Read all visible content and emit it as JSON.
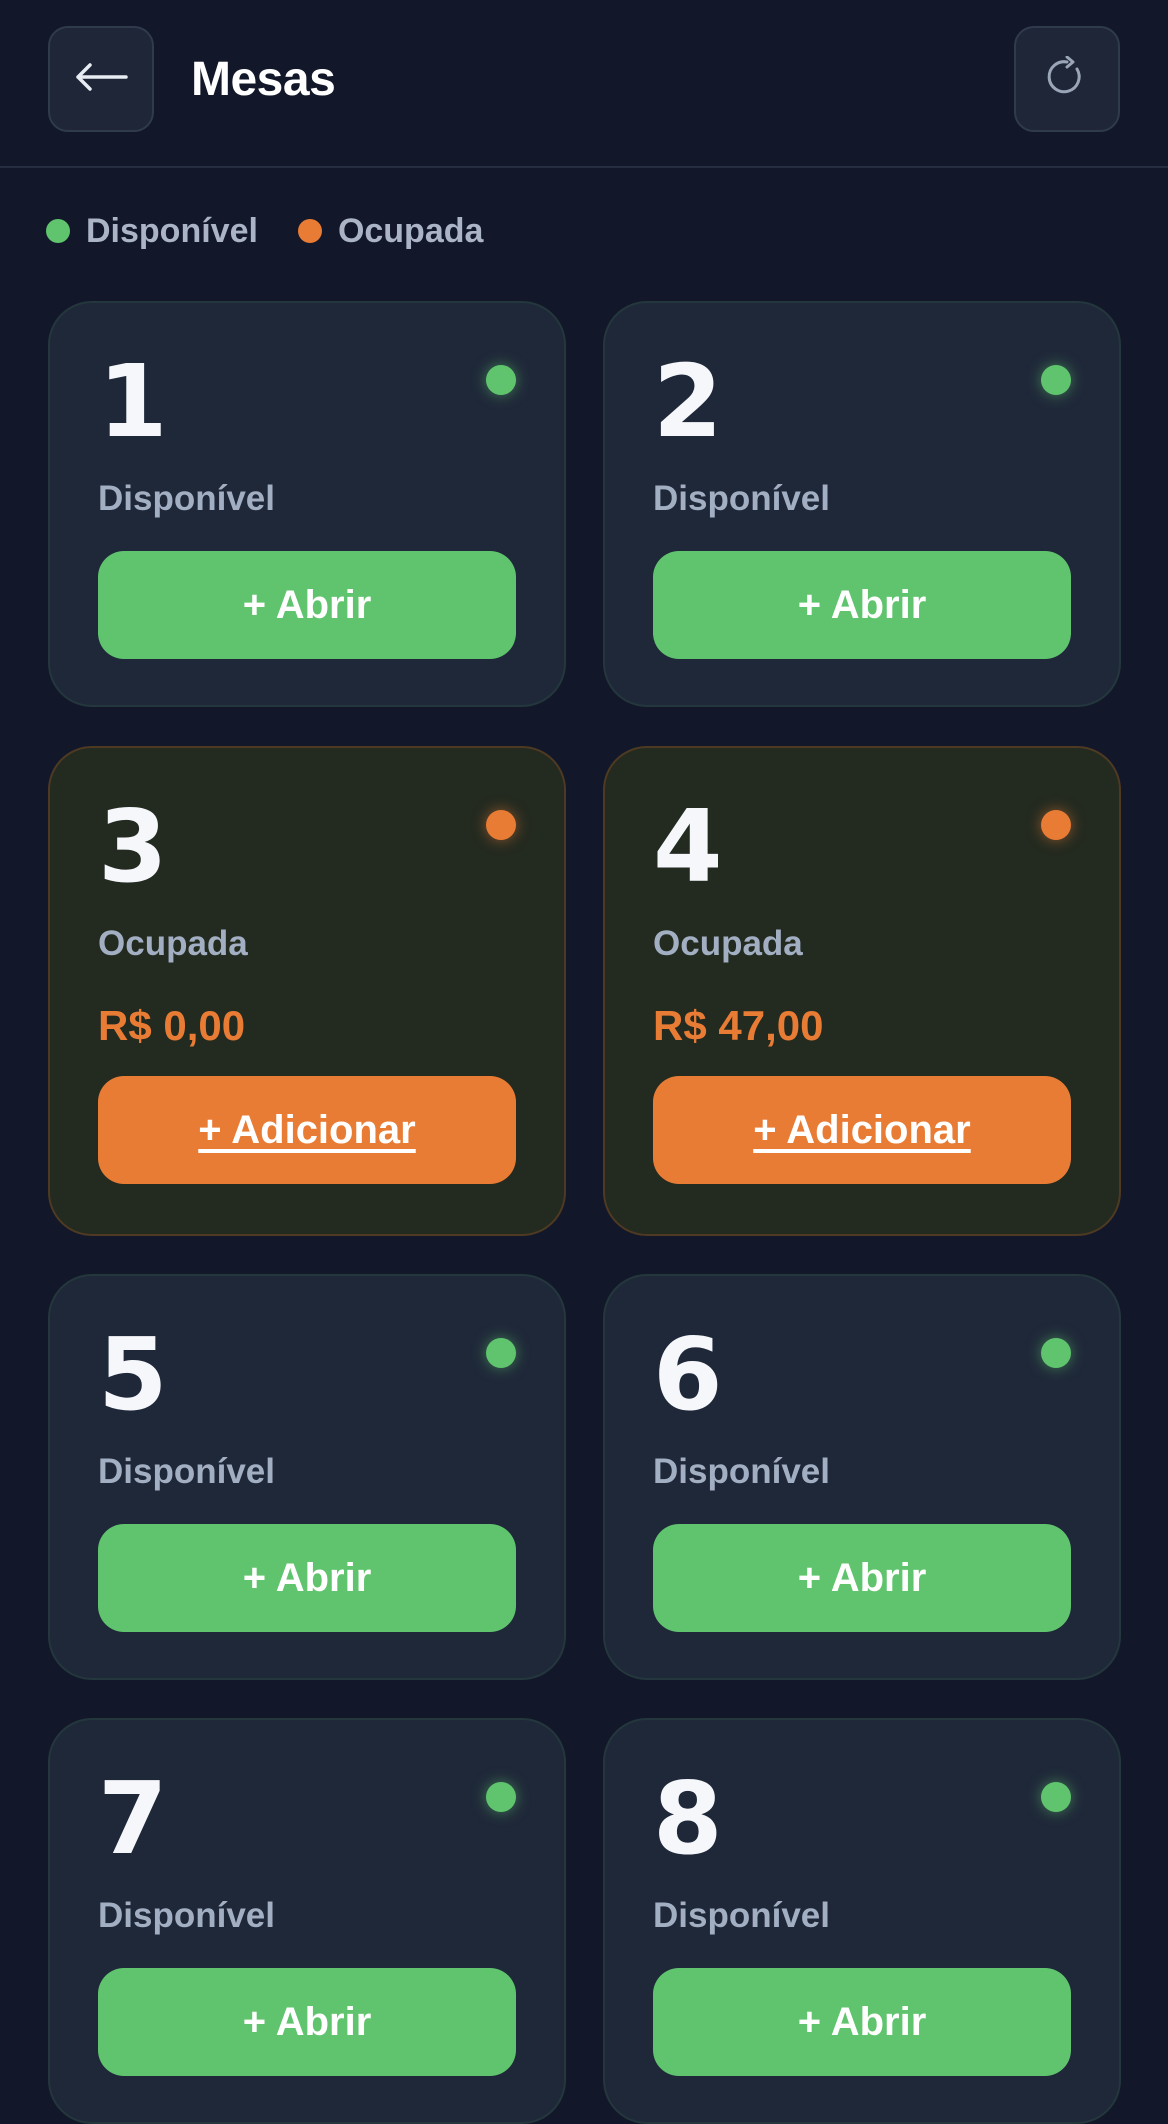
{
  "header": {
    "title": "Mesas",
    "back_icon": "arrow-left-icon",
    "refresh_icon": "refresh-icon"
  },
  "legend": {
    "available": "Disponível",
    "occupied": "Ocupada"
  },
  "colors": {
    "available": "#5fc46d",
    "occupied": "#e97c35",
    "background": "#121829",
    "card": "#1f2839"
  },
  "tables": [
    {
      "number": "1",
      "status": "Disponível",
      "button": "+ Abrir"
    },
    {
      "number": "2",
      "status": "Disponível",
      "button": "+ Abrir"
    },
    {
      "number": "3",
      "status": "Ocupada",
      "amount": "R$ 0,00",
      "button": "+ Adicionar"
    },
    {
      "number": "4",
      "status": "Ocupada",
      "amount": "R$ 47,00",
      "button": "+ Adicionar"
    },
    {
      "number": "5",
      "status": "Disponível",
      "button": "+ Abrir"
    },
    {
      "number": "6",
      "status": "Disponível",
      "button": "+ Abrir"
    },
    {
      "number": "7",
      "status": "Disponível",
      "button": "+ Abrir"
    },
    {
      "number": "8",
      "status": "Disponível",
      "button": "+ Abrir"
    }
  ]
}
